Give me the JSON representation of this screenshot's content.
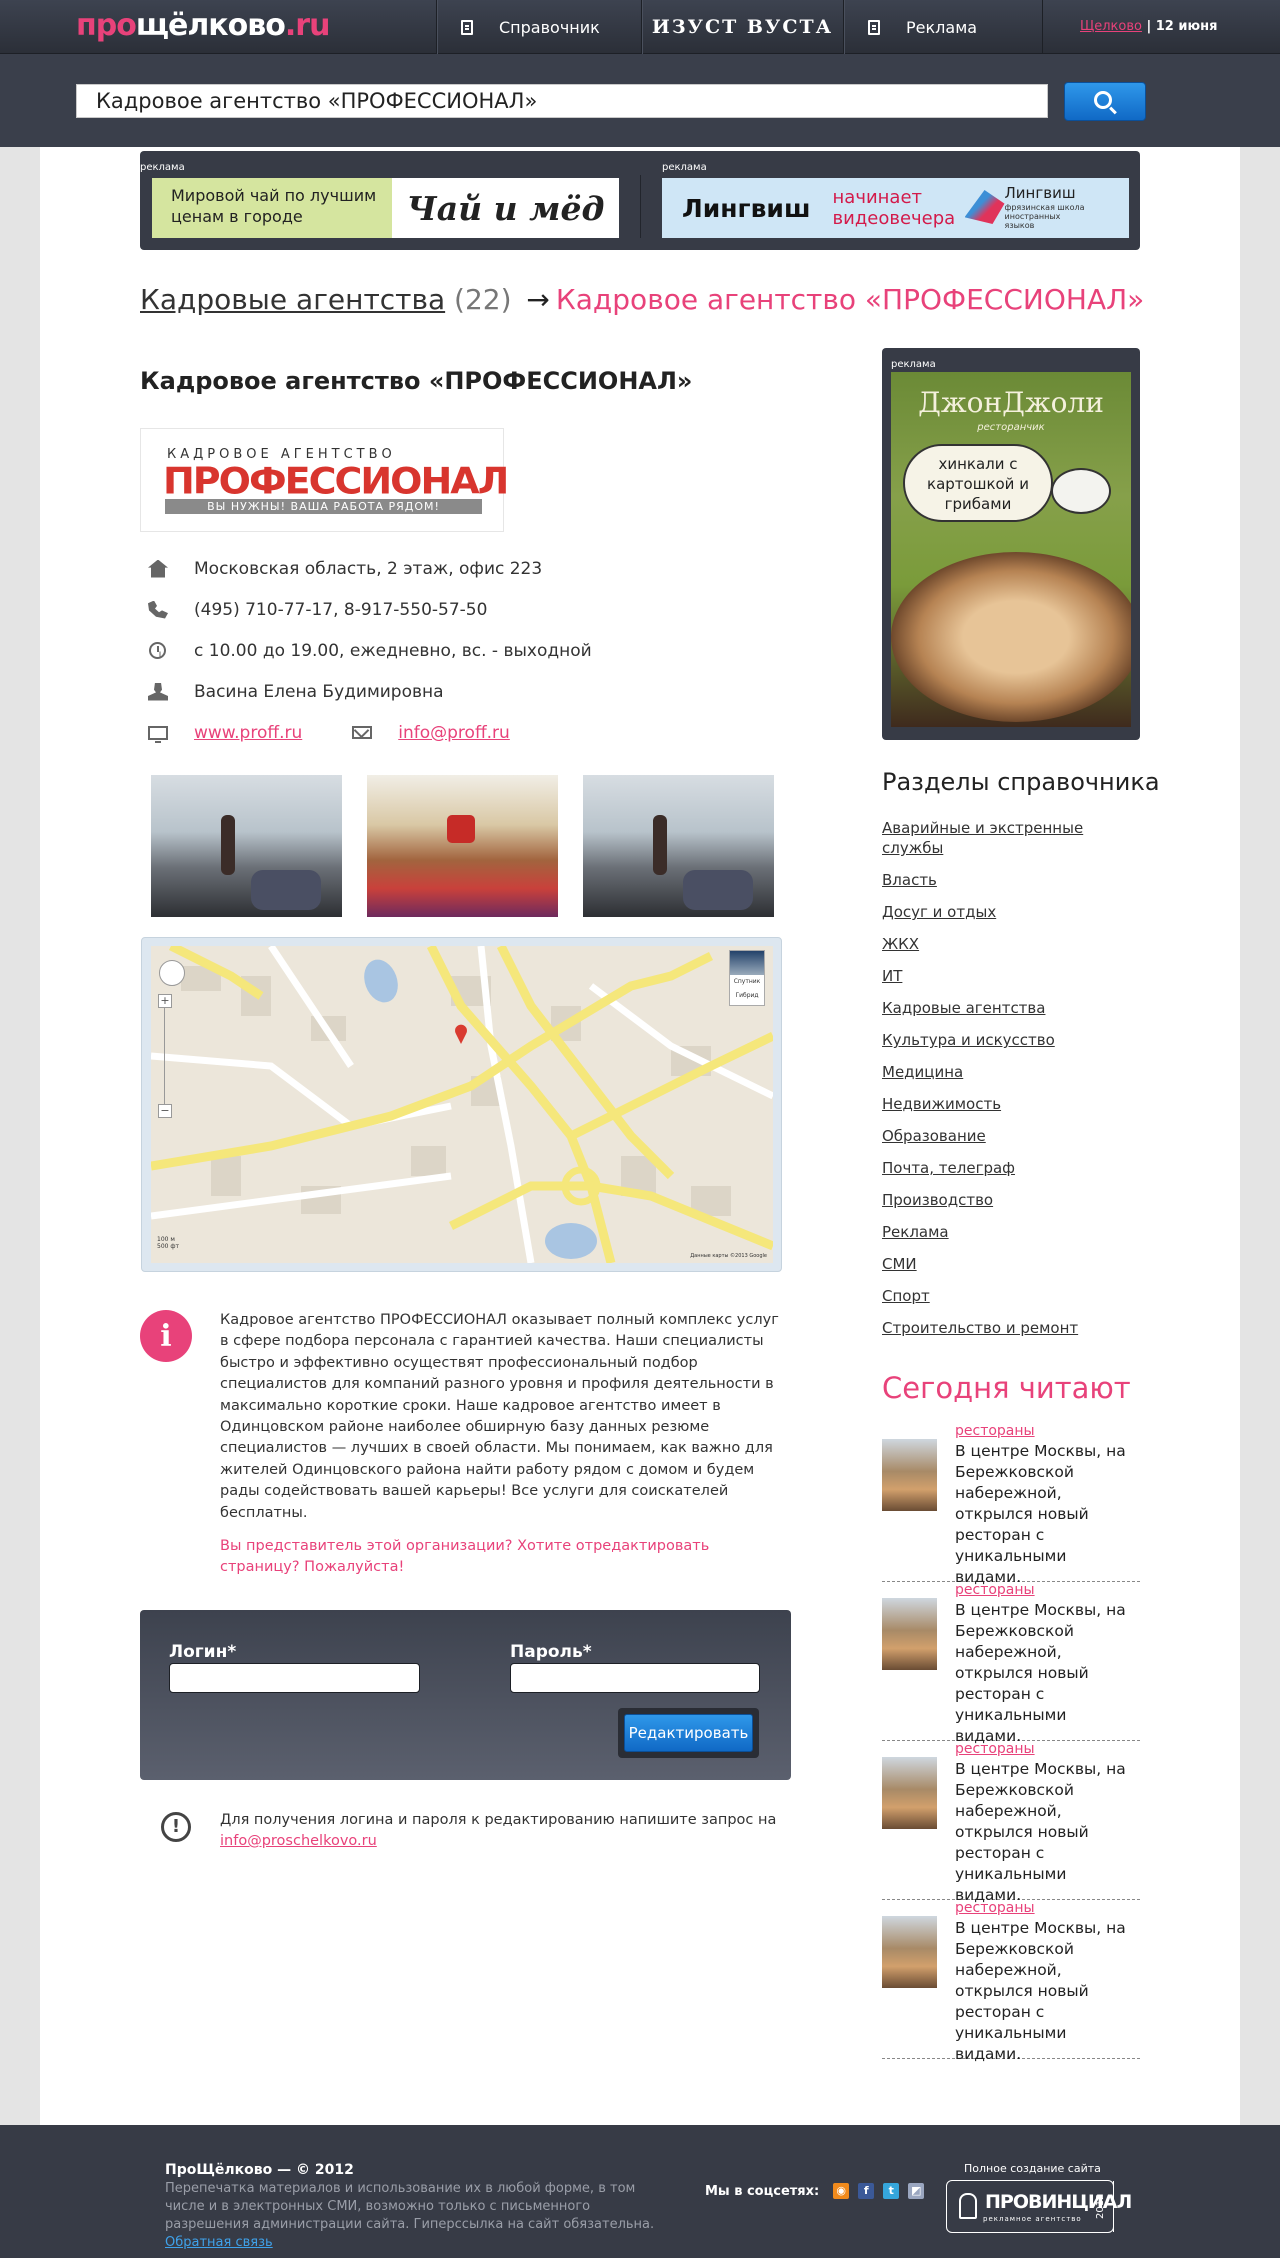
{
  "header": {
    "logo_prefix": "про",
    "logo_main": "щёлково",
    "logo_suffix": ".ru",
    "nav": {
      "directory": "Справочник",
      "izust": "ИЗУСТ ВУСТА",
      "ads": "Реклама"
    },
    "city": "Щелково",
    "date": "12 июня"
  },
  "search": {
    "value": "Кадровое агентство «ПРОФЕССИОНАЛ»"
  },
  "ads": {
    "label": "реклама",
    "tea": {
      "text": "Мировой чай по лучшим ценам в городе",
      "logo": "Чай и мёд"
    },
    "lingvish": {
      "logo": "Лингвиш",
      "text": "начинает видеовечера",
      "brand": "Лингвиш",
      "brand_sub": "фрязинская школа иностранных языков"
    }
  },
  "breadcrumb": {
    "category": "Кадровые агентства",
    "count": "(22)",
    "arrow": "→",
    "current": "Кадровое агентство «ПРОФЕССИОНАЛ»"
  },
  "org": {
    "title": "Кадровое агентство «ПРОФЕССИОНАЛ»",
    "logo_top": "КАДРОВОЕ АГЕНТСТВО",
    "logo_main": "ПРОФЕССИОНАЛ",
    "logo_slogan": "ВЫ НУЖНЫ! ВАША РАБОТА РЯДОМ!",
    "address": "Московская область, 2 этаж, офис 223",
    "phones": "(495) 710-77-17, 8-917-550-57-50",
    "hours": "с 10.00 до 19.00, ежедневно, вс. - выходной",
    "contact_person": "Васина Елена Будимировна",
    "website": "www.proff.ru",
    "email": "info@proff.ru",
    "description": "Кадровое агентство ПРОФЕССИОНАЛ оказывает полный комплекс услуг в сфере подбора персонала с гарантией качества. Наши специалисты быстро и эффективно осуществят профессиональный подбор специалистов для компаний разного уровня и профиля деятельности в максимально короткие сроки. Наше кадровое агентство имеет в Одинцовском районе наиболее обширную базу данных резюме специалистов — лучших в своей области. Мы понимаем, как важно для жителей Одинцовского района найти работу рядом с домом и будем рады содействовать вашей карьеры! Все услуги для соискателей бесплатны.",
    "owner_question": "Вы представитель этой организации? Хотите отредактировать страницу? Пожалуйста!"
  },
  "map": {
    "layer_satellite": "Спутник",
    "layer_hybrid": "Гибрид",
    "scale_m": "100 м",
    "scale_ft": "500 фт",
    "copyright": "Данные карты ©2013 Google"
  },
  "login": {
    "login_label": "Логин*",
    "password_label": "Пароль*",
    "login_value": "",
    "password_value": "",
    "submit": "Редактировать",
    "note": "Для получения логина и пароля к редактированию напишите запрос на",
    "note_email": "info@proschelkovo.ru"
  },
  "sidebar": {
    "ad_label": "реклама",
    "ad_brand": "ДжонДжоли",
    "ad_brand_sub": "ресторанчик",
    "ad_bubble": "хинкали с картошкой и грибами",
    "sections_title": "Разделы справочника",
    "sections": [
      "Аварийные и экстренные службы",
      "Власть",
      "Досуг и отдых",
      "ЖКХ",
      "ИТ",
      "Кадровые агентства",
      "Культура и искусство",
      "Медицина",
      "Недвижимость",
      "Образование",
      "Почта, телеграф",
      "Производство",
      "Реклама",
      "СМИ",
      "Спорт",
      "Строительство и ремонт"
    ],
    "today_title": "Сегодня читают",
    "news": [
      {
        "category": "рестораны",
        "text": "В центре Москвы, на Бережковской набережной, открылся новый ресторан с уникальными видами."
      },
      {
        "category": "рестораны",
        "text": "В центре Москвы, на Бережковской набережной, открылся новый ресторан с уникальными видами."
      },
      {
        "category": "рестораны",
        "text": "В центре Москвы, на Бережковской набережной, открылся новый ресторан с уникальными видами."
      },
      {
        "category": "рестораны",
        "text": "В центре Москвы, на Бережковской набережной, открылся новый ресторан с уникальными видами."
      }
    ]
  },
  "footer": {
    "title": "ПроЩёлково — © 2012",
    "text": "Перепечатка материалов и использование их в любой форме, в том числе и в электронных СМИ, возможно только с письменного разрешения администрации сайта. Гиперссылка на сайт обязательна.",
    "feedback": "Обратная связь",
    "social_label": "Мы в соцсетях:",
    "made_by": "Полное создание сайта",
    "agency_name": "ПРОВИНЦИАЛ",
    "agency_sub": "рекламное агентство",
    "agency_year": "2012"
  },
  "colors": {
    "accent": "#e8427a",
    "header_bg": "#373b46",
    "button_blue": "#1a7fd9"
  },
  "icons": [
    "search-icon",
    "document-icon",
    "home-icon",
    "phone-icon",
    "clock-icon",
    "person-icon",
    "monitor-icon",
    "mail-icon",
    "info-icon",
    "exclamation-icon",
    "rss-icon",
    "facebook-icon",
    "twitter-icon",
    "delicious-icon"
  ]
}
